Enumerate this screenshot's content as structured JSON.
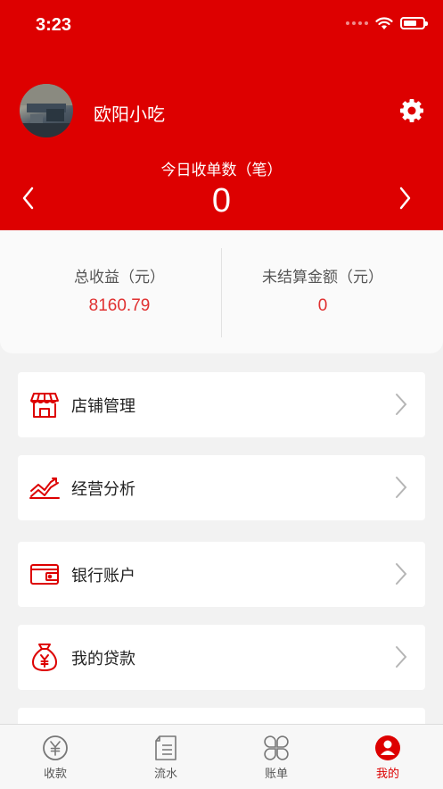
{
  "status_bar": {
    "time": "3:23"
  },
  "header": {
    "shop_name": "欧阳小吃",
    "today_orders_label": "今日收单数（笔）",
    "today_orders_value": "0"
  },
  "stats": {
    "total_income_label": "总收益（元）",
    "total_income_value": "8160.79",
    "unsettled_label": "未结算金额（元）",
    "unsettled_value": "0"
  },
  "menu": {
    "items": [
      {
        "label": "店铺管理",
        "icon": "storefront-icon"
      },
      {
        "label": "经营分析",
        "icon": "chart-icon"
      },
      {
        "label": "银行账户",
        "icon": "wallet-icon"
      },
      {
        "label": "我的贷款",
        "icon": "money-bag-icon"
      }
    ]
  },
  "tabbar": {
    "tabs": [
      {
        "label": "收款",
        "icon": "yuan-coin-icon"
      },
      {
        "label": "流水",
        "icon": "document-list-icon"
      },
      {
        "label": "账单",
        "icon": "grid-petals-icon"
      },
      {
        "label": "我的",
        "icon": "user-icon",
        "active": true
      }
    ]
  },
  "colors": {
    "brand_red": "#dd0000",
    "value_red": "#e03030",
    "inactive_gray": "#777777"
  }
}
